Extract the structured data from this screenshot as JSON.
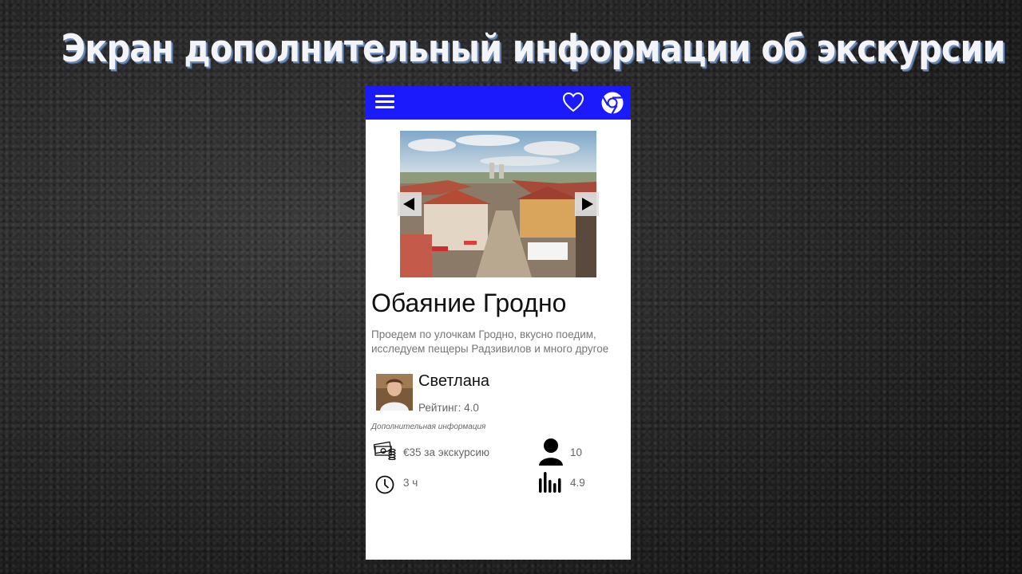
{
  "slide_title": "Экран дополнительный информации об экскурсии",
  "appbar": {
    "background": "#1a1afc",
    "icons": [
      "menu-icon",
      "heart-icon",
      "chrome-icon"
    ]
  },
  "tour": {
    "title": "Обаяние Гродно",
    "description": "Проедем по улочкам Гродно, вкусно поедим, исследуем пещеры Радзивилов и много другое"
  },
  "gallery": {
    "prev_icon": "arrow-left-icon",
    "next_icon": "arrow-right-icon"
  },
  "guide": {
    "name": "Светлана",
    "rating": "Рейтинг: 4.0"
  },
  "additional_info": {
    "label": "Дополнительная информация",
    "price": "€35 за экскурсию",
    "duration": "3 ч",
    "group_size": "10",
    "score": "4.9"
  }
}
